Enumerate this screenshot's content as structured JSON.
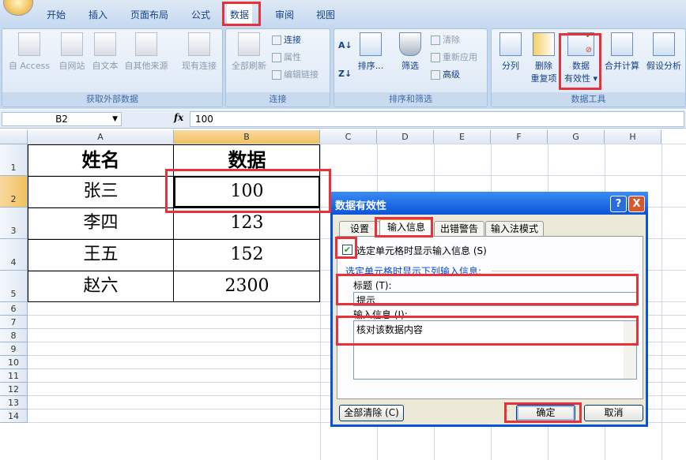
{
  "tabs": [
    "开始",
    "插入",
    "页面布局",
    "公式",
    "数据",
    "审阅",
    "视图"
  ],
  "ribbon": {
    "external": {
      "label": "获取外部数据",
      "items": [
        "自 Access",
        "自网站",
        "自文本",
        "自其他来源",
        "现有连接"
      ]
    },
    "connections": {
      "label": "连接",
      "refresh": "全部刷新",
      "items": [
        "连接",
        "属性",
        "编辑链接"
      ]
    },
    "sort": {
      "label": "排序和筛选",
      "sort": "排序...",
      "filter": "筛选",
      "items": [
        "清除",
        "重新应用",
        "高级"
      ]
    },
    "tools": {
      "label": "数据工具",
      "split": "分列",
      "dedup1": "删除",
      "dedup2": "重复项",
      "valid1": "数据",
      "valid2": "有效性",
      "consolidate": "合并计算",
      "whatif": "假设分析"
    }
  },
  "formula": {
    "cell": "B2",
    "fx": "fx",
    "value": "100"
  },
  "columns": [
    "A",
    "B",
    "C",
    "D",
    "E",
    "F",
    "G",
    "H"
  ],
  "rows": [
    "1",
    "2",
    "3",
    "4",
    "5",
    "6",
    "7",
    "8",
    "9",
    "10",
    "11",
    "12",
    "13",
    "14"
  ],
  "table": [
    [
      "姓名",
      "数据"
    ],
    [
      "张三",
      "100"
    ],
    [
      "李四",
      "123"
    ],
    [
      "王五",
      "152"
    ],
    [
      "赵六",
      "2300"
    ]
  ],
  "dialog": {
    "title": "数据有效性",
    "help": "?",
    "close": "X",
    "tabs": [
      "设置",
      "输入信息",
      "出错警告",
      "输入法模式"
    ],
    "checkbox_label": "选定单元格时显示输入信息 (S)",
    "section": "选定单元格时显示下列输入信息:",
    "title_label": "标题 (T):",
    "title_value": "提示",
    "info_label": "输入信息 (I):",
    "info_value": "核对该数据内容",
    "clear": "全部清除 (C)",
    "ok": "确定",
    "cancel": "取消"
  }
}
